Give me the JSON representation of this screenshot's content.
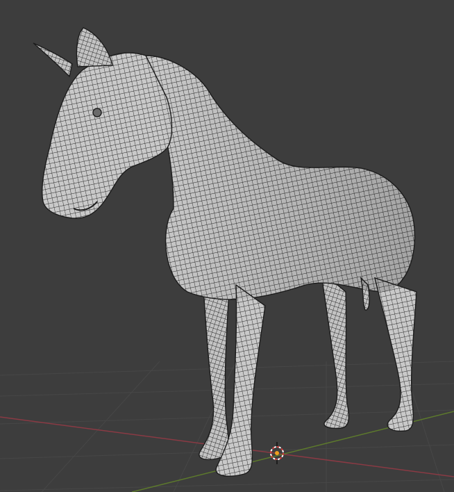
{
  "app": "Blender",
  "editor": "3d-viewport",
  "scene": {
    "object": "horse-mesh",
    "display_mode": "solid-wireframe",
    "background_color": "#3d3d3d",
    "grid_color": "#4a4a4a",
    "x_axis_color": "#8a3a44",
    "y_axis_color": "#5d7a2c",
    "mesh_color": "#c8c8c8",
    "wire_color": "#1e1e1e",
    "cursor_icon": "3d-cursor-icon"
  }
}
